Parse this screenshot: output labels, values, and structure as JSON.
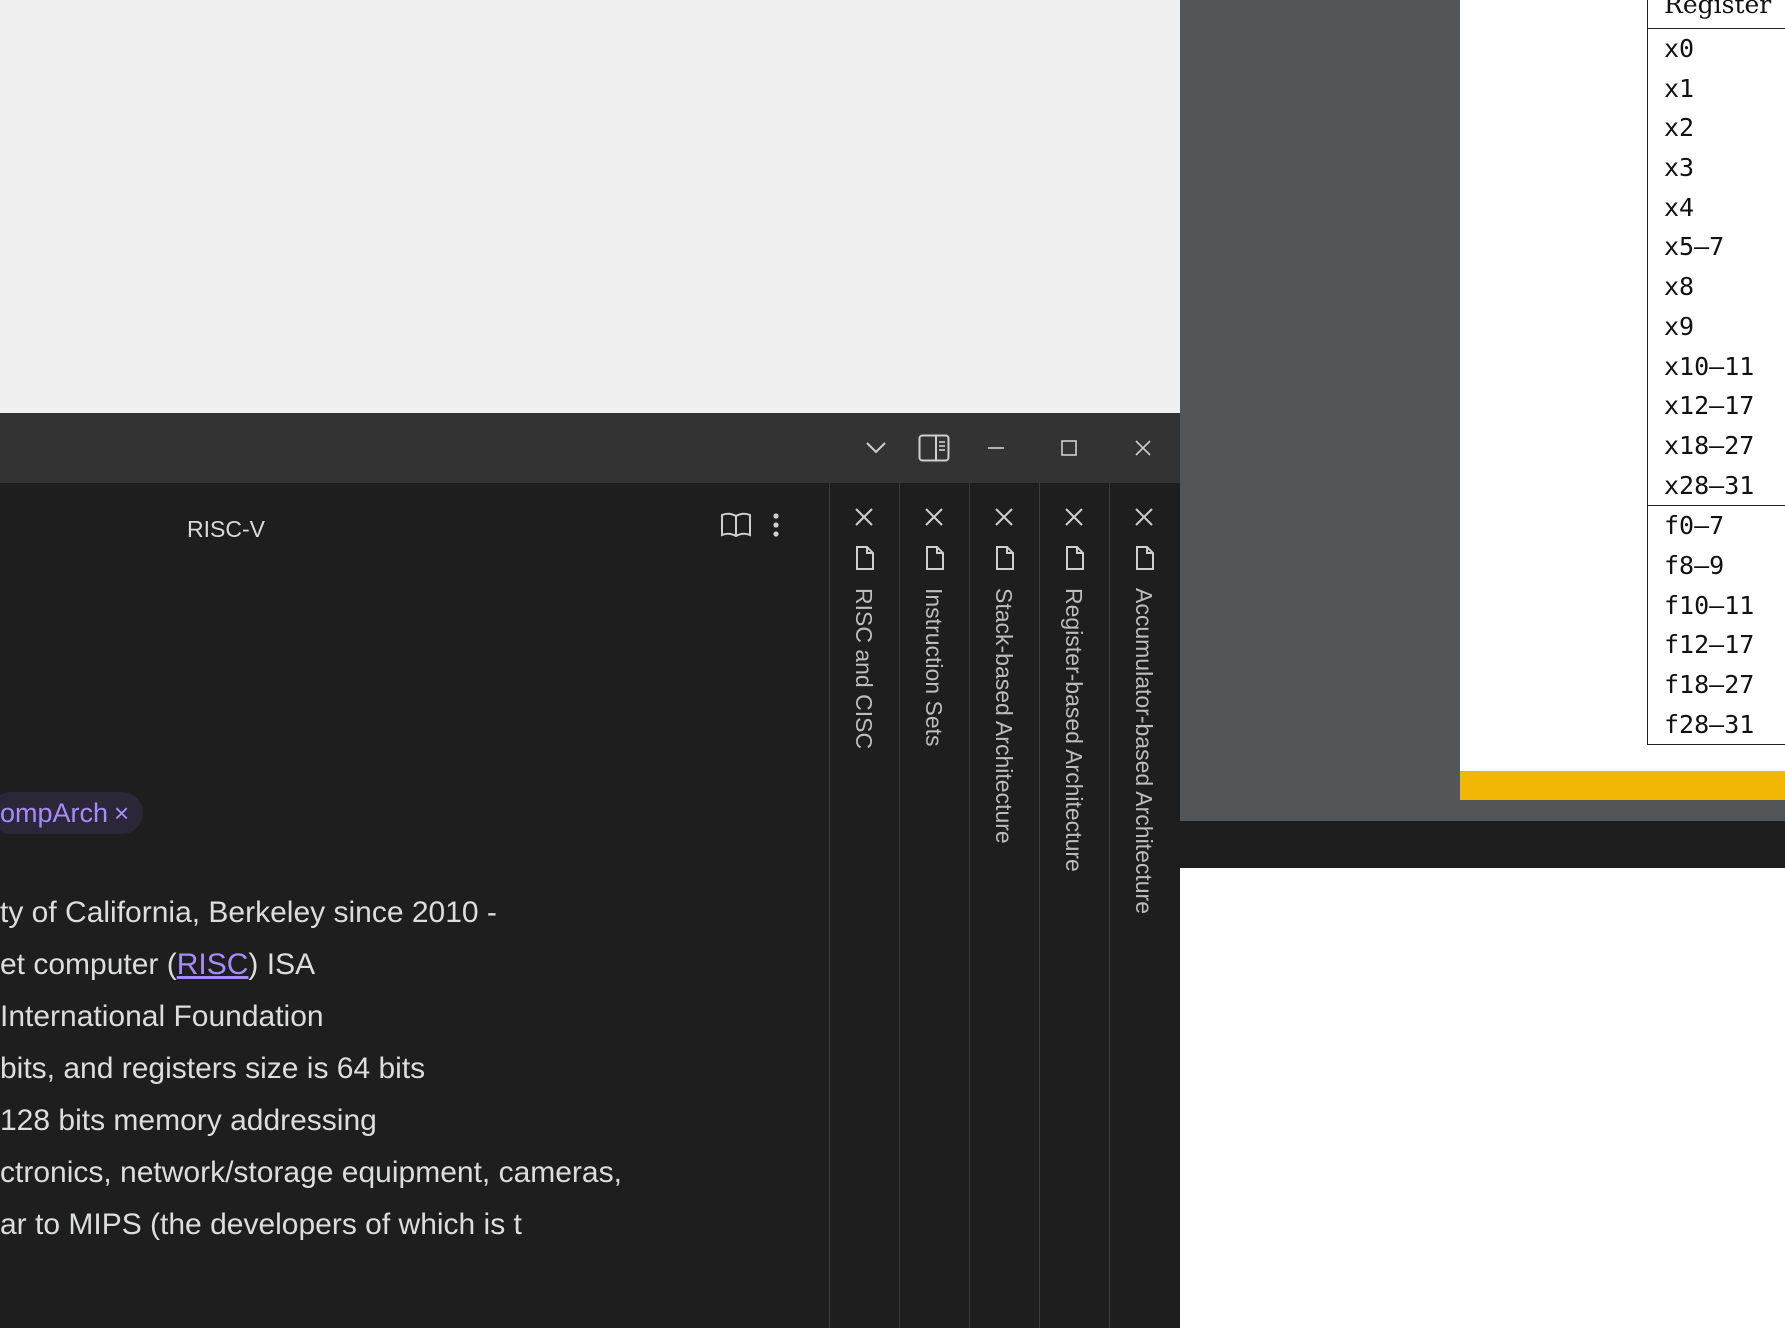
{
  "note": {
    "title": "RISC-V",
    "tag_visible": "ompArch",
    "tag_remove": "×",
    "lines": [
      {
        "before": "ty of California, Berkeley since 2010 -",
        "link": "",
        "after": ""
      },
      {
        "before": "et computer (",
        "link": "RISC",
        "after": ") ISA"
      },
      {
        "before": " International Foundation",
        "link": "",
        "after": ""
      },
      {
        "before": "bits, and registers size is 64 bits",
        "link": "",
        "after": ""
      },
      {
        "before": "128 bits memory addressing",
        "link": "",
        "after": ""
      },
      {
        "before": "ctronics, network/storage equipment, cameras,",
        "link": "",
        "after": ""
      },
      {
        "before": "ar to MIPS (the developers of which is t",
        "link": "",
        "after": ""
      }
    ]
  },
  "stacked_tabs": [
    {
      "label": "RISC and CISC"
    },
    {
      "label": "Instruction Sets"
    },
    {
      "label": "Stack-based Architecture"
    },
    {
      "label": "Register-based Architecture"
    },
    {
      "label": "Accumulator-based Architecture"
    }
  ],
  "pdf": {
    "table_header": "Register",
    "registers": [
      "x0",
      "x1",
      "x2",
      "x3",
      "x4",
      "x5–7",
      "x8",
      "x9",
      "x10–11",
      "x12–17",
      "x18–27",
      "x28–31"
    ],
    "fp_registers": [
      "f0–7",
      "f8–9",
      "f10–11",
      "f12–17",
      "f18–27",
      "f28–31"
    ],
    "accent_color": "#f2b705"
  },
  "colors": {
    "tag_text": "#a88bfa",
    "editor_bg": "#1e1e1e",
    "titlebar_bg": "#333333"
  }
}
